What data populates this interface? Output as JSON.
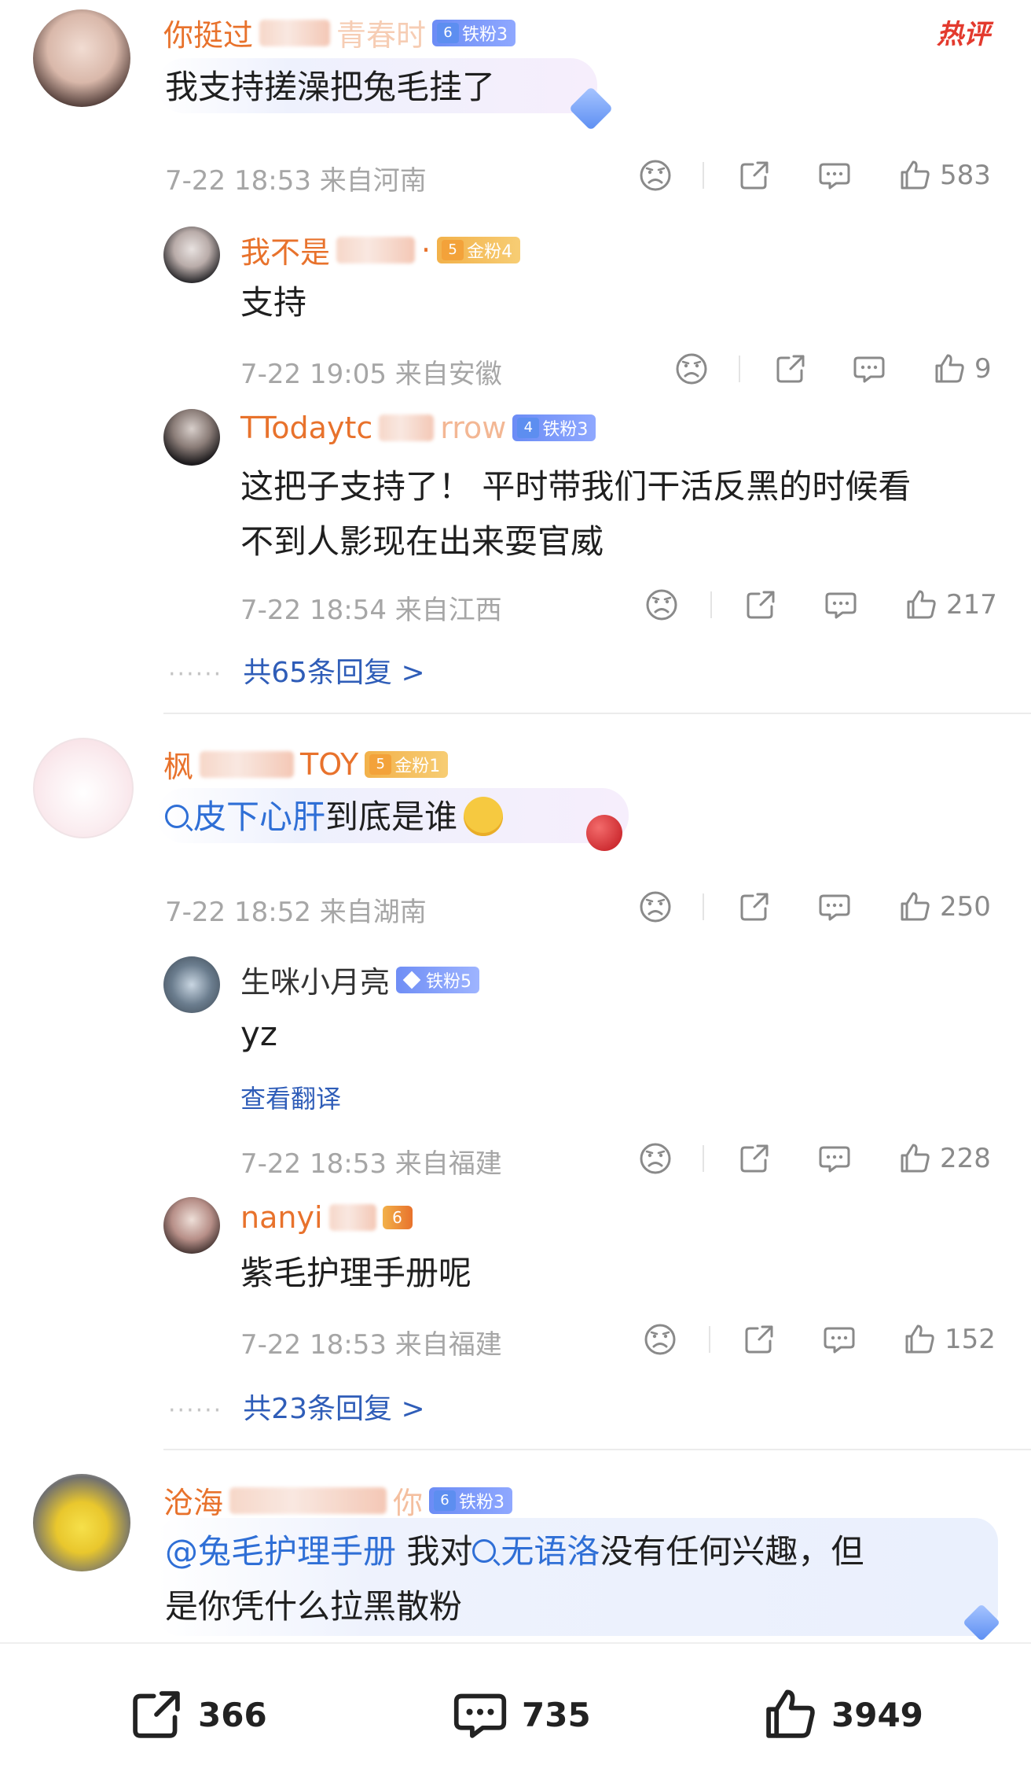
{
  "comments": [
    {
      "name_visible": "你挺过",
      "name_tail": "青春时",
      "badge": "铁粉3",
      "badge_level": "6",
      "hot": "热评",
      "text": "我支持搓澡把兔毛挂了",
      "meta": "7-22 18:53 来自河南",
      "likes": "583",
      "replies": [
        {
          "name": "我不是",
          "name_tail": "·",
          "badge": "金粉4",
          "badge_level": "5",
          "text": "支持",
          "meta": "7-22 19:05 来自安徽",
          "likes": "9"
        },
        {
          "name": "TTodaytc",
          "name_tail": "rrow",
          "badge": "铁粉3",
          "badge_level": "4",
          "text_line1": "这把子支持了！ 平时带我们干活反黑的时候看",
          "text_line2": "不到人影现在出来耍官威",
          "meta": "7-22 18:54 来自江西",
          "likes": "217"
        }
      ],
      "more_replies": "共65条回复 >"
    },
    {
      "name_visible": "枫",
      "name_tail": "TOY",
      "badge": "金粉1",
      "badge_level": "5",
      "text_link": "皮下心肝",
      "text_rest": "到底是谁",
      "meta": "7-22 18:52 来自湖南",
      "likes": "250",
      "replies": [
        {
          "name": "生咪小月亮",
          "badge": "铁粉5",
          "text": "yz",
          "translate": "查看翻译",
          "meta": "7-22 18:53 来自福建",
          "likes": "228"
        },
        {
          "name": "nanyi",
          "badge_level": "6",
          "text": "紫毛护理手册呢",
          "meta": "7-22 18:53 来自福建",
          "likes": "152"
        }
      ],
      "more_replies": "共23条回复 >"
    },
    {
      "name_visible": "沧海",
      "name_tail": "你",
      "badge": "铁粉3",
      "badge_level": "6",
      "mention": "@兔毛护理手册",
      "text_mid": " 我对",
      "text_link": "无语洛",
      "text_rest": "没有任何兴趣，但",
      "text_line2": "是你凭什么拉黑散粉"
    }
  ],
  "bottom_bar": {
    "reposts": "366",
    "comments": "735",
    "likes": "3949"
  }
}
